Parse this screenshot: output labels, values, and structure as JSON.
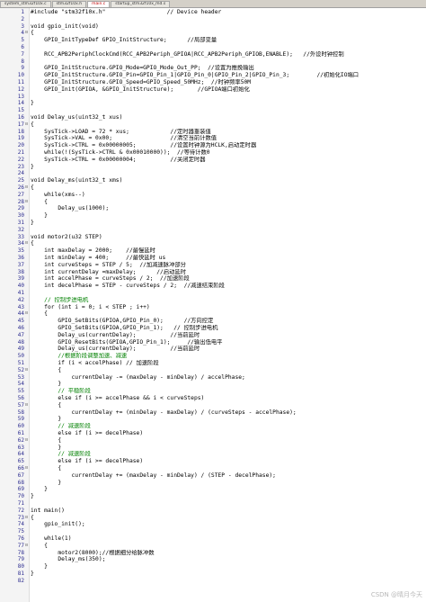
{
  "tabs": [
    {
      "label": "system_stm32f10x.c",
      "active": false
    },
    {
      "label": "stm32f10x.h",
      "active": false
    },
    {
      "label": "main.c",
      "active": true
    },
    {
      "label": "startup_stm32f10x_md.s",
      "active": false
    }
  ],
  "code_lines": [
    {
      "n": "1",
      "text": "#include \"stm32f10x.h\"                  // Device header",
      "fold": ""
    },
    {
      "n": "2",
      "text": "",
      "fold": ""
    },
    {
      "n": "3",
      "text": "void gpio_init(void)",
      "fold": ""
    },
    {
      "n": "4",
      "text": "{",
      "fold": "⊟"
    },
    {
      "n": "5",
      "text": "    GPIO_InitTypeDef GPIO_InitStructure;      //局部变量",
      "fold": ""
    },
    {
      "n": "6",
      "text": "",
      "fold": ""
    },
    {
      "n": "7",
      "text": "    RCC_APB2PeriphClockCmd(RCC_APB2Periph_GPIOA|RCC_APB2Periph_GPIOB,ENABLE);   //外设时钟控制",
      "fold": ""
    },
    {
      "n": "8",
      "text": "",
      "fold": ""
    },
    {
      "n": "9",
      "text": "    GPIO_InitStructure.GPIO_Mode=GPIO_Mode_Out_PP;  //设置为推挽输出",
      "fold": ""
    },
    {
      "n": "10",
      "text": "    GPIO_InitStructure.GPIO_Pin=GPIO_Pin_1|GPIO_Pin_0|GPIO_Pin_2|GPIO_Pin_3;        //初始化IO端口",
      "fold": ""
    },
    {
      "n": "11",
      "text": "    GPIO_InitStructure.GPIO_Speed=GPIO_Speed_50MHz;  //时钟频率50M",
      "fold": ""
    },
    {
      "n": "12",
      "text": "    GPIO_Init(GPIOA, &GPIO_InitStructure);       //GPIOA端口初始化",
      "fold": ""
    },
    {
      "n": "13",
      "text": "",
      "fold": ""
    },
    {
      "n": "14",
      "text": "}",
      "fold": ""
    },
    {
      "n": "15",
      "text": "",
      "fold": ""
    },
    {
      "n": "16",
      "text": "void Delay_us(uint32_t xus)",
      "fold": ""
    },
    {
      "n": "17",
      "text": "{",
      "fold": "⊟"
    },
    {
      "n": "18",
      "text": "    SysTick->LOAD = 72 * xus;            //定时器重装值",
      "fold": ""
    },
    {
      "n": "19",
      "text": "    SysTick->VAL = 0x00;                 //清空当前计数值",
      "fold": ""
    },
    {
      "n": "20",
      "text": "    SysTick->CTRL = 0x00000005;          //设置时钟源为HCLK,启动定时器",
      "fold": ""
    },
    {
      "n": "21",
      "text": "    while(!(SysTick->CTRL & 0x00010000));  //等待计数0",
      "fold": ""
    },
    {
      "n": "22",
      "text": "    SysTick->CTRL = 0x00000004;          //关闭定时器",
      "fold": ""
    },
    {
      "n": "23",
      "text": "}",
      "fold": ""
    },
    {
      "n": "24",
      "text": "",
      "fold": ""
    },
    {
      "n": "25",
      "text": "void Delay_ms(uint32_t xms)",
      "fold": ""
    },
    {
      "n": "26",
      "text": "{",
      "fold": "⊟"
    },
    {
      "n": "27",
      "text": "    while(xms--)",
      "fold": ""
    },
    {
      "n": "28",
      "text": "    {",
      "fold": "⊟"
    },
    {
      "n": "29",
      "text": "        Delay_us(1000);",
      "fold": ""
    },
    {
      "n": "30",
      "text": "    }",
      "fold": ""
    },
    {
      "n": "31",
      "text": "}",
      "fold": ""
    },
    {
      "n": "32",
      "text": "",
      "fold": ""
    },
    {
      "n": "33",
      "text": "void motor2(u32 STEP)",
      "fold": ""
    },
    {
      "n": "34",
      "text": "{",
      "fold": "⊟"
    },
    {
      "n": "35",
      "text": "    int maxDelay = 2000;    //最慢延时",
      "fold": ""
    },
    {
      "n": "36",
      "text": "    int minDelay = 400;     //最快延时 us",
      "fold": ""
    },
    {
      "n": "37",
      "text": "    int curveSteps = STEP / 5;  //加减速脉冲部分",
      "fold": ""
    },
    {
      "n": "38",
      "text": "    int currentDelay =maxDelay;      //启动延时",
      "fold": ""
    },
    {
      "n": "39",
      "text": "    int accelPhase = curveSteps / 2;  //加速阶段",
      "fold": ""
    },
    {
      "n": "40",
      "text": "    int decelPhase = STEP - curveSteps / 2;  //减速结束阶段",
      "fold": ""
    },
    {
      "n": "41",
      "text": "",
      "fold": ""
    },
    {
      "n": "42",
      "text": "    // 控制步进电机",
      "fold": ""
    },
    {
      "n": "43",
      "text": "    for (int i = 0; i < STEP ; i++)",
      "fold": ""
    },
    {
      "n": "44",
      "text": "    {",
      "fold": "⊟"
    },
    {
      "n": "45",
      "text": "        GPIO_SetBits(GPIOA,GPIO_Pin_0);      //方向控定",
      "fold": ""
    },
    {
      "n": "46",
      "text": "        GPIO_SetBits(GPIOA,GPIO_Pin_1);   // 控制步进电机",
      "fold": ""
    },
    {
      "n": "47",
      "text": "        Delay_us(currentDelay);          //当前延时",
      "fold": ""
    },
    {
      "n": "48",
      "text": "        GPIO_ResetBits(GPIOA,GPIO_Pin_1);     //输出低电平",
      "fold": ""
    },
    {
      "n": "49",
      "text": "        Delay_us(currentDelay);          //当前延时",
      "fold": ""
    },
    {
      "n": "50",
      "text": "        //根据阶段调整加速、减速",
      "fold": ""
    },
    {
      "n": "51",
      "text": "        if (i < accelPhase) // 加速阶段",
      "fold": ""
    },
    {
      "n": "52",
      "text": "        {",
      "fold": "⊟"
    },
    {
      "n": "53",
      "text": "            currentDelay -= (maxDelay - minDelay) / accelPhase;",
      "fold": ""
    },
    {
      "n": "54",
      "text": "        }",
      "fold": ""
    },
    {
      "n": "55",
      "text": "        // 平稳阶段",
      "fold": ""
    },
    {
      "n": "56",
      "text": "        else if (i >= accelPhase && i < curveSteps)",
      "fold": ""
    },
    {
      "n": "57",
      "text": "        {",
      "fold": "⊟"
    },
    {
      "n": "58",
      "text": "            currentDelay += (minDelay - maxDelay) / (curveSteps - accelPhase);",
      "fold": ""
    },
    {
      "n": "59",
      "text": "        }",
      "fold": ""
    },
    {
      "n": "60",
      "text": "        // 减速阶段",
      "fold": ""
    },
    {
      "n": "61",
      "text": "        else if (i >= decelPhase)",
      "fold": ""
    },
    {
      "n": "62",
      "text": "        {",
      "fold": "⊟"
    },
    {
      "n": "63",
      "text": "        }",
      "fold": ""
    },
    {
      "n": "64",
      "text": "        // 减速阶段",
      "fold": ""
    },
    {
      "n": "65",
      "text": "        else if (i >= decelPhase)",
      "fold": ""
    },
    {
      "n": "66",
      "text": "        {",
      "fold": "⊟"
    },
    {
      "n": "67",
      "text": "            currentDelay += (maxDelay - minDelay) / (STEP - decelPhase);",
      "fold": ""
    },
    {
      "n": "68",
      "text": "        }",
      "fold": ""
    },
    {
      "n": "69",
      "text": "    }",
      "fold": ""
    },
    {
      "n": "70",
      "text": "}",
      "fold": ""
    },
    {
      "n": "71",
      "text": "",
      "fold": ""
    },
    {
      "n": "72",
      "text": "int main()",
      "fold": ""
    },
    {
      "n": "73",
      "text": "{",
      "fold": "⊟"
    },
    {
      "n": "74",
      "text": "    gpio_init();",
      "fold": ""
    },
    {
      "n": "75",
      "text": "",
      "fold": ""
    },
    {
      "n": "76",
      "text": "    while(1)",
      "fold": ""
    },
    {
      "n": "77",
      "text": "    {",
      "fold": "⊟"
    },
    {
      "n": "78",
      "text": "        motor2(8000);//根据细分给脉冲数",
      "fold": ""
    },
    {
      "n": "79",
      "text": "        Delay_ms(350);",
      "fold": ""
    },
    {
      "n": "80",
      "text": "    }",
      "fold": ""
    },
    {
      "n": "81",
      "text": "}",
      "fold": ""
    },
    {
      "n": "82",
      "text": "",
      "fold": ""
    }
  ],
  "watermark": "CSDN @晴月今天"
}
